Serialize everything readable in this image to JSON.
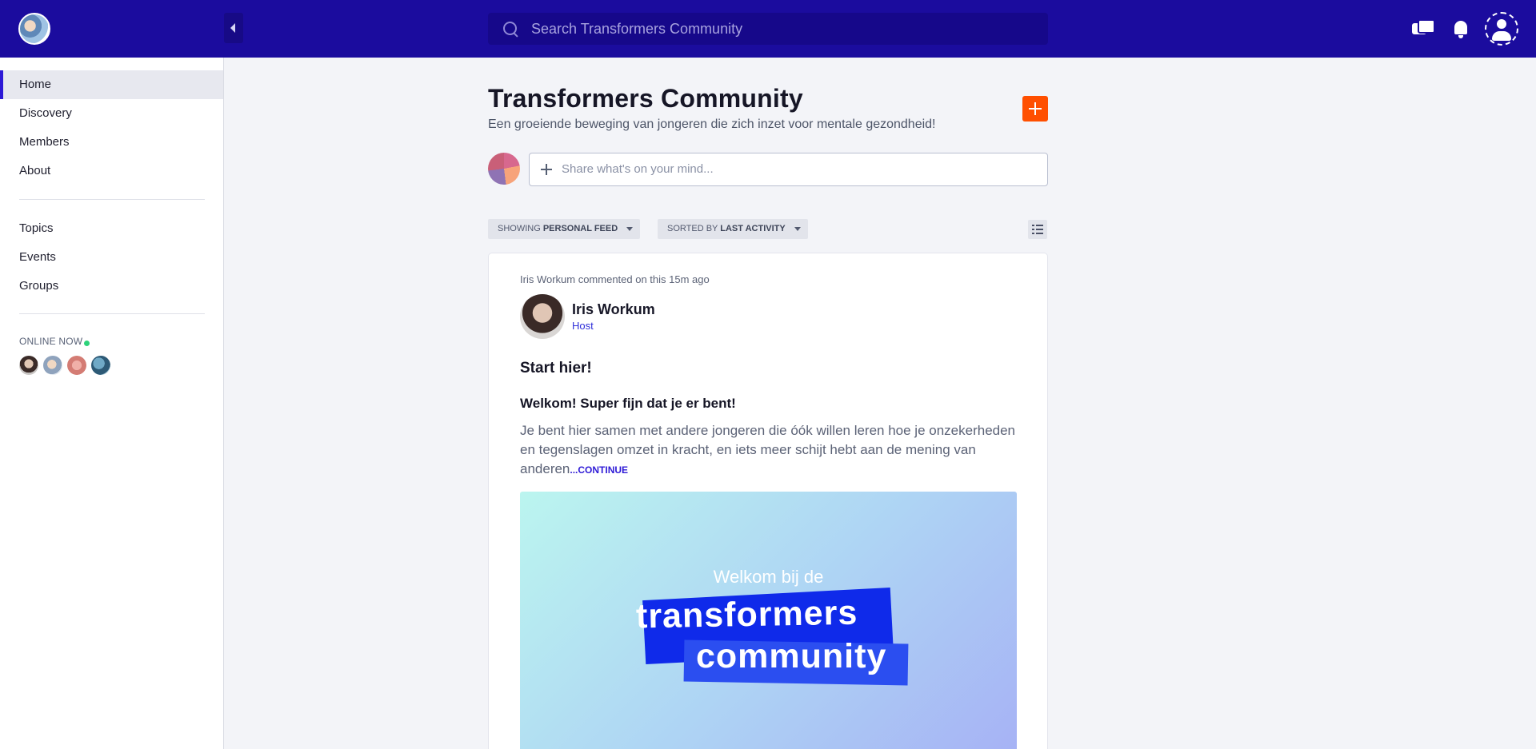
{
  "header": {
    "logo_icon": "community-logo-icon",
    "search_placeholder": "Search Transformers Community",
    "icons": [
      "chat-icon",
      "bell-icon",
      "profile-icon"
    ],
    "brand_color": "#1b0c9e"
  },
  "sidebar": {
    "items": [
      {
        "label": "Home",
        "active": true
      },
      {
        "label": "Discovery"
      },
      {
        "label": "Members"
      },
      {
        "label": "About"
      }
    ],
    "secondary_items": [
      {
        "label": "Topics"
      },
      {
        "label": "Events"
      },
      {
        "label": "Groups"
      }
    ],
    "online_now_label": "ONLINE NOW",
    "online_count": 4,
    "accent_color": "#2d19d6"
  },
  "main": {
    "title": "Transformers Community",
    "subtitle": "Een groeiende beweging van jongeren die zich inzet voor mentale gezondheid!",
    "composer_placeholder": "Share what's on your mind...",
    "add_button_color": "#ff4f00",
    "filters": {
      "showing_prefix": "SHOWING",
      "showing_value": "PERSONAL FEED",
      "sorted_prefix": "SORTED BY",
      "sorted_value": "LAST ACTIVITY"
    }
  },
  "post": {
    "activity": "Iris Workum commented on this 15m ago",
    "author": "Iris Workum",
    "role": "Host",
    "title": "Start hier!",
    "heading": "Welkom! Super fijn dat je er bent!",
    "body": "Je bent hier samen met andere jongeren die óók willen leren hoe je onzekerheden en tegenslagen omzet in kracht, en iets meer schijt hebt aan de mening van anderen",
    "continue_label": "...CONTINUE",
    "banner": {
      "line1": "Welkom bij de",
      "line2": "transformers",
      "line3": "community"
    }
  }
}
